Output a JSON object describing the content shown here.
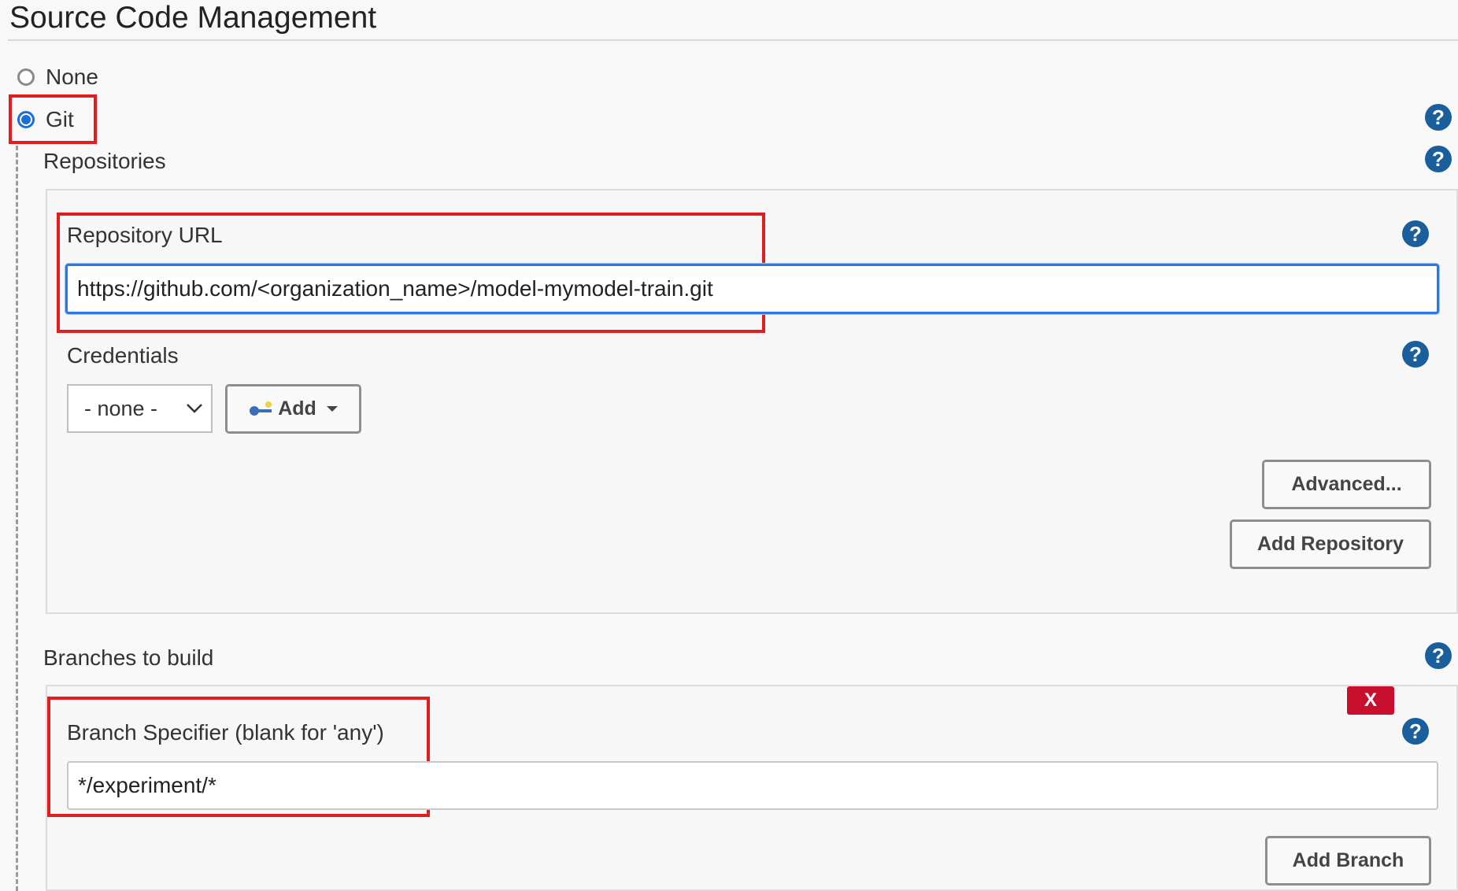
{
  "section": {
    "title": "Source Code Management"
  },
  "scm_options": [
    {
      "label": "None",
      "selected": false
    },
    {
      "label": "Git",
      "selected": true
    }
  ],
  "repositories": {
    "label": "Repositories",
    "repository_url_label": "Repository URL",
    "repository_url_value": "https://github.com/<organization_name>/model-mymodel-train.git",
    "credentials_label": "Credentials",
    "credentials_selected": "- none -",
    "add_label": "Add",
    "advanced_label": "Advanced...",
    "add_repository_label": "Add Repository"
  },
  "branches": {
    "label": "Branches to build",
    "delete_label": "X",
    "branch_specifier_label": "Branch Specifier (blank for 'any')",
    "branch_specifier_value": "*/experiment/*",
    "add_branch_label": "Add Branch"
  },
  "help_icon_glyph": "?",
  "colors": {
    "accent_blue": "#2b78e4",
    "help_blue": "#1a5f9c",
    "highlight_red": "#e01e1e",
    "delete_red": "#c8102e"
  }
}
